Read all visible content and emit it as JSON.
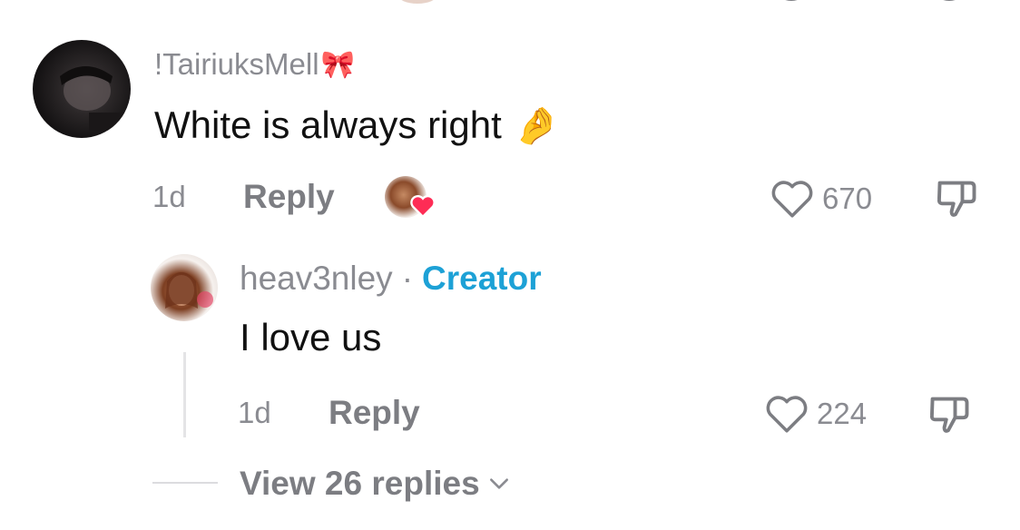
{
  "top_comment": {
    "username": "!TairiuksMell",
    "username_emoji": "🎀",
    "text": "White is always right",
    "text_emoji": "🤌",
    "time": "1d",
    "reply_label": "Reply",
    "likes": "670",
    "creator_liked": true
  },
  "reply": {
    "username": "heav3nley",
    "separator": "·",
    "badge": "Creator",
    "text": "I love us",
    "time": "1d",
    "reply_label": "Reply",
    "likes": "224"
  },
  "view_replies": {
    "label": "View 26 replies"
  },
  "colors": {
    "creator_badge": "#1da1d6",
    "heart_red": "#fe2c55",
    "muted_text": "#8a8b91",
    "icon_grey": "#7c7d82"
  },
  "icons": {
    "like": "heart-outline-icon",
    "dislike": "thumbs-down-icon",
    "more": "chevron-down-icon"
  }
}
